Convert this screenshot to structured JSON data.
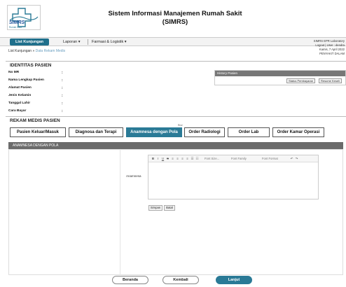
{
  "header": {
    "logo_text": "SIMRS",
    "logo_subtext": "Rumah Sakit",
    "title_line1": "Sistem Informasi Manajemen Rumah Sakit",
    "title_line2": "(SIMRS)"
  },
  "nav": {
    "active": "List Kunjungan",
    "items": [
      "Laporan ▾",
      "Farmasi & Logistik ▾"
    ]
  },
  "breadcrumb": {
    "home": "List Kunjungan",
    "sep": " » ",
    "current": "Data Rekam Medis"
  },
  "userinfo": {
    "line1": "SIMRS EPR Laboratory",
    "line2": "Logout | User : dendra",
    "line3": "Kamis, 7 April 2022",
    "line4": "PENYAKIT DALAM"
  },
  "patient": {
    "title": "IDENTITAS PASIEN",
    "fields": [
      "No MR",
      "Nama Lengkap Pasien",
      "Alamat Pasien",
      "Jenis Kelamin",
      "Tanggal Lahir",
      "Cara Bayar"
    ],
    "colon": ":"
  },
  "history": {
    "title": "History Pasien",
    "btn_status": "Status Pembayaran",
    "btn_resume": "Resume Keseh"
  },
  "rekam": {
    "title": "REKAM MEDIS PASIEN",
    "tab_small_label": "Rnd",
    "tabs": [
      "Pasien Keluar/Masuk",
      "Diagnosa dan Terapi",
      "Anamnesa dengan Pola",
      "Order Radiologi",
      "Order Lab",
      "Order Kamar Operasi"
    ]
  },
  "anamnesa": {
    "header": "ANAMNESA DENGAN POLA",
    "label": "Anamnesa",
    "toolbar": {
      "bold": "B",
      "italic": "I",
      "underline": "U",
      "strike": "S",
      "font_size": "Font Size...",
      "font_family": "Font Family",
      "font_format": "Font Format"
    },
    "btn_save": "Simpan",
    "btn_cancel": "Batal"
  },
  "footer": {
    "beranda": "Beranda",
    "kembali": "Kembali",
    "lanjut": "Lanjut"
  },
  "colors": {
    "accent": "#2a7a96",
    "header_gray": "#6b6b6b"
  }
}
